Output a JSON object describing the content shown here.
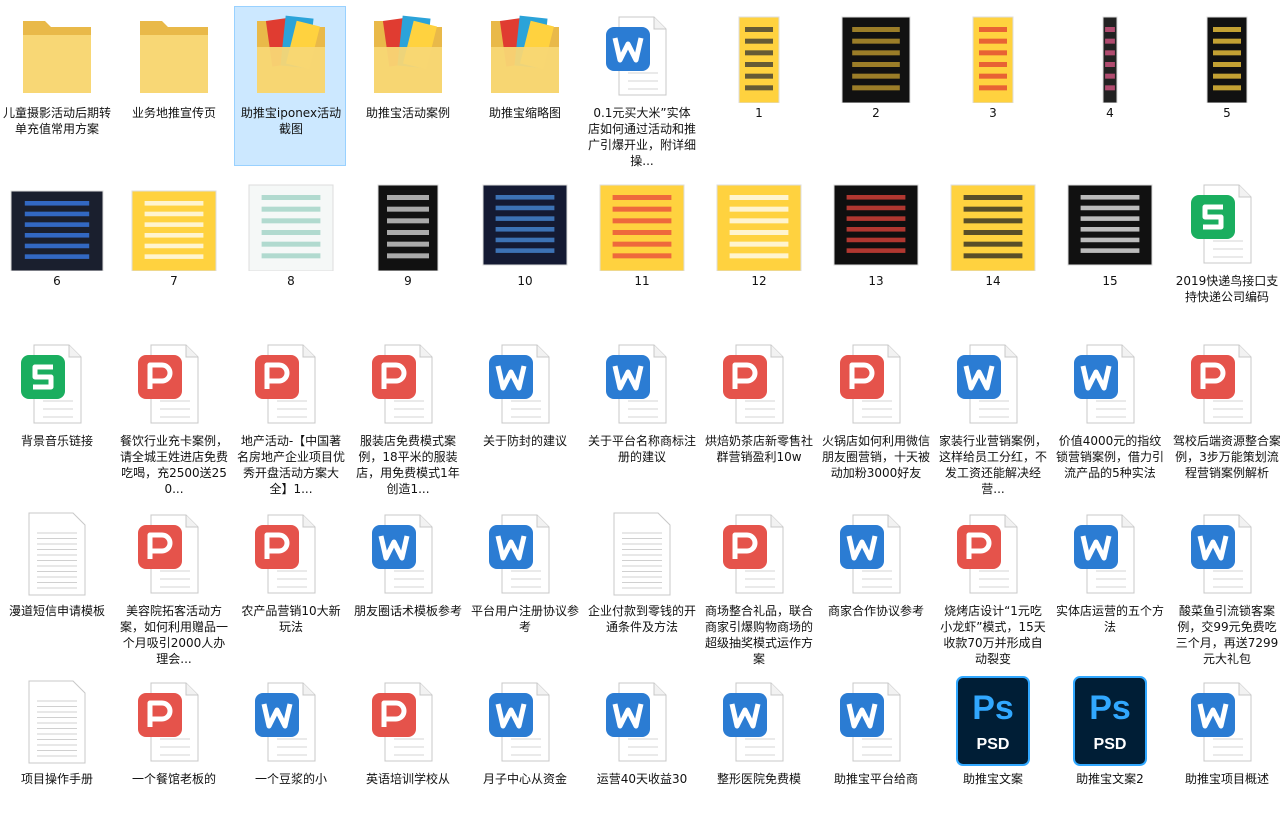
{
  "colors": {
    "selection": "#cce8ff",
    "folder": "#f8d775",
    "word": "#2b7cd3",
    "pdf": "#e5534b",
    "sheet": "#1aae5f",
    "psd_bg": "#001e36",
    "psd_fg": "#31a8ff"
  },
  "items": [
    {
      "label": "儿童摄影活动后期转单充值常用方案",
      "type": "folder"
    },
    {
      "label": "业务地推宣传页",
      "type": "folder"
    },
    {
      "label": "助推宝iponex活动截图",
      "type": "folder-content",
      "selected": true
    },
    {
      "label": "助推宝活动案例",
      "type": "folder-content"
    },
    {
      "label": "助推宝缩略图",
      "type": "folder-content"
    },
    {
      "label": "0.1元买大米”实体店如何通过活动和推广引爆开业，附详细操...",
      "type": "word"
    },
    {
      "label": "1",
      "type": "image",
      "variant": "yellow-doc"
    },
    {
      "label": "2",
      "type": "image",
      "variant": "dark-text"
    },
    {
      "label": "3",
      "type": "image",
      "variant": "colorful-grid"
    },
    {
      "label": "4",
      "type": "image",
      "variant": "tall-strip"
    },
    {
      "label": "5",
      "type": "image",
      "variant": "dark-dots"
    },
    {
      "label": "6",
      "type": "image",
      "variant": "dark-screens"
    },
    {
      "label": "7",
      "type": "image",
      "variant": "yellow-list"
    },
    {
      "label": "8",
      "type": "image",
      "variant": "certificate"
    },
    {
      "label": "9",
      "type": "image",
      "variant": "qr-poster"
    },
    {
      "label": "10",
      "type": "image",
      "variant": "phones"
    },
    {
      "label": "11",
      "type": "image",
      "variant": "yellow-phones"
    },
    {
      "label": "12",
      "type": "image",
      "variant": "yellow-phone"
    },
    {
      "label": "13",
      "type": "image",
      "variant": "dashboard"
    },
    {
      "label": "14",
      "type": "image",
      "variant": "yellow-list2"
    },
    {
      "label": "15",
      "type": "image",
      "variant": "dark-grid"
    },
    {
      "label": "2019快递鸟接口支持快递公司编码",
      "type": "sheet"
    },
    {
      "label": "背景音乐链接",
      "type": "sheet"
    },
    {
      "label": "餐饮行业充卡案例，请全城王姓进店免费吃喝，充2500送250...",
      "type": "pdf"
    },
    {
      "label": "地产活动-【中国著名房地产企业项目优秀开盘活动方案大全】1...",
      "type": "pdf"
    },
    {
      "label": "服装店免费模式案例，18平米的服装店，用免费模式1年创造1...",
      "type": "pdf"
    },
    {
      "label": "关于防封的建议",
      "type": "word"
    },
    {
      "label": "关于平台名称商标注册的建议",
      "type": "word"
    },
    {
      "label": "烘焙奶茶店新零售社群营销盈利10w",
      "type": "pdf"
    },
    {
      "label": "火锅店如何利用微信朋友圈营销，十天被动加粉3000好友",
      "type": "pdf"
    },
    {
      "label": "家装行业营销案例，这样给员工分红，不发工资还能解决经营...",
      "type": "word"
    },
    {
      "label": "价值4000元的指纹锁营销案例，借力引流产品的5种实法",
      "type": "word"
    },
    {
      "label": "驾校后端资源整合案例，3步万能策划流程营销案例解析",
      "type": "pdf"
    },
    {
      "label": "漫道短信申请模板",
      "type": "text"
    },
    {
      "label": "美容院拓客活动方案，如何利用赠品一个月吸引2000人办理会...",
      "type": "pdf"
    },
    {
      "label": "农产品营销10大新玩法",
      "type": "pdf"
    },
    {
      "label": "朋友圈话术模板参考",
      "type": "word"
    },
    {
      "label": "平台用户注册协议参考",
      "type": "word"
    },
    {
      "label": "企业付款到零钱的开通条件及方法",
      "type": "text"
    },
    {
      "label": "商场整合礼品，联合商家引爆购物商场的超级抽奖模式运作方案",
      "type": "pdf"
    },
    {
      "label": "商家合作协议参考",
      "type": "word"
    },
    {
      "label": "烧烤店设计“1元吃小龙虾”模式，15天收款70万并形成自动裂变",
      "type": "pdf"
    },
    {
      "label": "实体店运营的五个方法",
      "type": "word"
    },
    {
      "label": "酸菜鱼引流锁客案例，交99元免费吃三个月，再送7299元大礼包",
      "type": "word"
    },
    {
      "label": "项目操作手册",
      "type": "text"
    },
    {
      "label": "一个餐馆老板的",
      "type": "pdf"
    },
    {
      "label": "一个豆浆的小",
      "type": "word"
    },
    {
      "label": "英语培训学校从",
      "type": "pdf"
    },
    {
      "label": "月子中心从资金",
      "type": "word"
    },
    {
      "label": "运营40天收益30",
      "type": "word"
    },
    {
      "label": "整形医院免费模",
      "type": "word"
    },
    {
      "label": "助推宝平台给商",
      "type": "word"
    },
    {
      "label": "助推宝文案",
      "type": "psd"
    },
    {
      "label": "助推宝文案2",
      "type": "psd"
    },
    {
      "label": "助推宝项目概述",
      "type": "word"
    }
  ]
}
